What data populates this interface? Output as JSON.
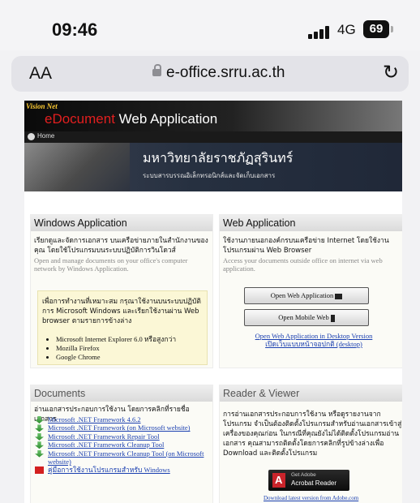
{
  "status_bar": {
    "time": "09:46",
    "network": "4G",
    "battery": "69"
  },
  "browser": {
    "text_size": "AA",
    "domain": "e-office.srru.ac.th"
  },
  "header": {
    "logo_text": "Vision Net",
    "app_title_red": "eDocument",
    "app_title_white": " Web Application",
    "home_label": "Home",
    "university_name": "มหาวิทยาลัยราชภัฏสุรินทร์",
    "system_subtitle": "ระบบสารบรรณอิเล็กทรอนิกส์และจัดเก็บเอกสาร"
  },
  "windows_app": {
    "title": "Windows Application",
    "desc_th": "เรียกดูและจัดการเอกสาร บนเครือข่ายภายในสำนักงานของคุณ โดยใช้โปรแกรมบนระบบปฏิบัติการวินโดวส์",
    "desc_en": "Open and manage documents on your office's computer network by Windows Application.",
    "note_text": "เพื่อการทำงานที่เหมาะสม กรุณาใช้งานบนระบบปฏิบัติการ Microsoft Windows และเรียกใช้งานผ่าน Web browser ตามรายการข้างล่าง",
    "browsers": [
      "Microsoft Internet Explorer 6.0 หรือสูงกว่า",
      "Mozilla Firefox",
      "Google Chrome"
    ]
  },
  "web_app": {
    "title": "Web Application",
    "desc_th": "ใช้งานภายนอกองค์กรบนเครือข่าย Internet โดยใช้งานโปรแกรมผ่าน Web Browser",
    "desc_en": "Access your documents outside office on internet via web application.",
    "open_web_button": "Open Web Application",
    "open_mobile_button": "Open Mobile Web",
    "desktop_link_en": "Open Web Application in Desktop Version",
    "desktop_link_th": "เปิดเว็บแบบหน้าจอปกติ (desktop)"
  },
  "documents": {
    "title": "Documents",
    "desc_th": "อ่านเอกสารประกอบการใช้งาน โดยการคลิกที่รายชื่อเอกสาร",
    "items": [
      "Microsoft .NET Framework 4.6.2",
      "Microsoft .NET Framework (on Microsoft website)",
      "Microsoft .NET Framework Repair Tool",
      "Microsoft .NET Framework Cleanup Tool",
      "Microsoft .NET Framework Cleanup Tool (on Microsoft website)"
    ],
    "manual_link": "คู่มือการใช้งานโปรแกรมสำหรับ Windows"
  },
  "reader": {
    "title": "Reader & Viewer",
    "desc_th": "การอ่านเอกสารประกอบการใช้งาน หรือดูรายงานจากโปรแกรม จำเป็นต้องติดตั้งโปรแกรมสำหรับอ่านเอกสารเข้าสู่เครื่องของคุณก่อน ในกรณีที่คุณยังไม่ได้ติดตั้งโปรแกรมอ่านเอกสาร คุณสามารถติดตั้งโดยการคลิกที่รูปข้างล่างเพื่อ Download และติดตั้งโปรแกรม",
    "adobe_get": "Get Adobe",
    "adobe_name": "Acrobat Reader",
    "download_link": "Download latest version from Adobe.com"
  }
}
